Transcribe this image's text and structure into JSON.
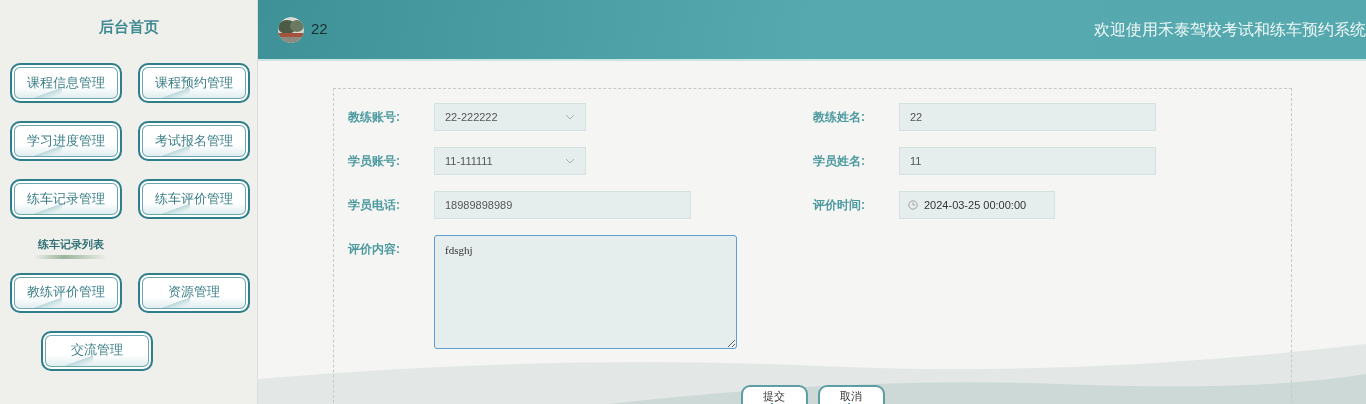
{
  "sidebar": {
    "title": "后台首页",
    "items": [
      {
        "kind": "menu",
        "label": "课程信息管理"
      },
      {
        "kind": "menu",
        "label": "课程预约管理"
      },
      {
        "kind": "menu",
        "label": "学习进度管理"
      },
      {
        "kind": "menu",
        "label": "考试报名管理"
      },
      {
        "kind": "menu",
        "label": "练车记录管理"
      },
      {
        "kind": "menu",
        "label": "练车评价管理"
      },
      {
        "kind": "submenu",
        "label": "练车记录列表"
      },
      {
        "kind": "menu",
        "label": "教练评价管理"
      },
      {
        "kind": "menu",
        "label": "资源管理"
      },
      {
        "kind": "menu",
        "label": "交流管理"
      }
    ]
  },
  "header": {
    "user": "22",
    "welcome": "欢迎使用禾泰驾校考试和练车预约系统"
  },
  "form": {
    "fields": [
      {
        "kind": "select",
        "label": "教练账号:",
        "value": "22-222222"
      },
      {
        "kind": "text",
        "label": "教练姓名:",
        "value": "22"
      },
      {
        "kind": "select",
        "label": "学员账号:",
        "value": "11-111111"
      },
      {
        "kind": "text",
        "label": "学员姓名:",
        "value": "11"
      },
      {
        "kind": "text",
        "label": "学员电话:",
        "value": "18989898989"
      },
      {
        "kind": "datetime",
        "label": "评价时间:",
        "value": "2024-03-25 00:00:00"
      },
      {
        "kind": "textarea",
        "label": "评价内容:",
        "value": "fdsghj"
      }
    ],
    "buttons": [
      "提交",
      "取消"
    ]
  }
}
